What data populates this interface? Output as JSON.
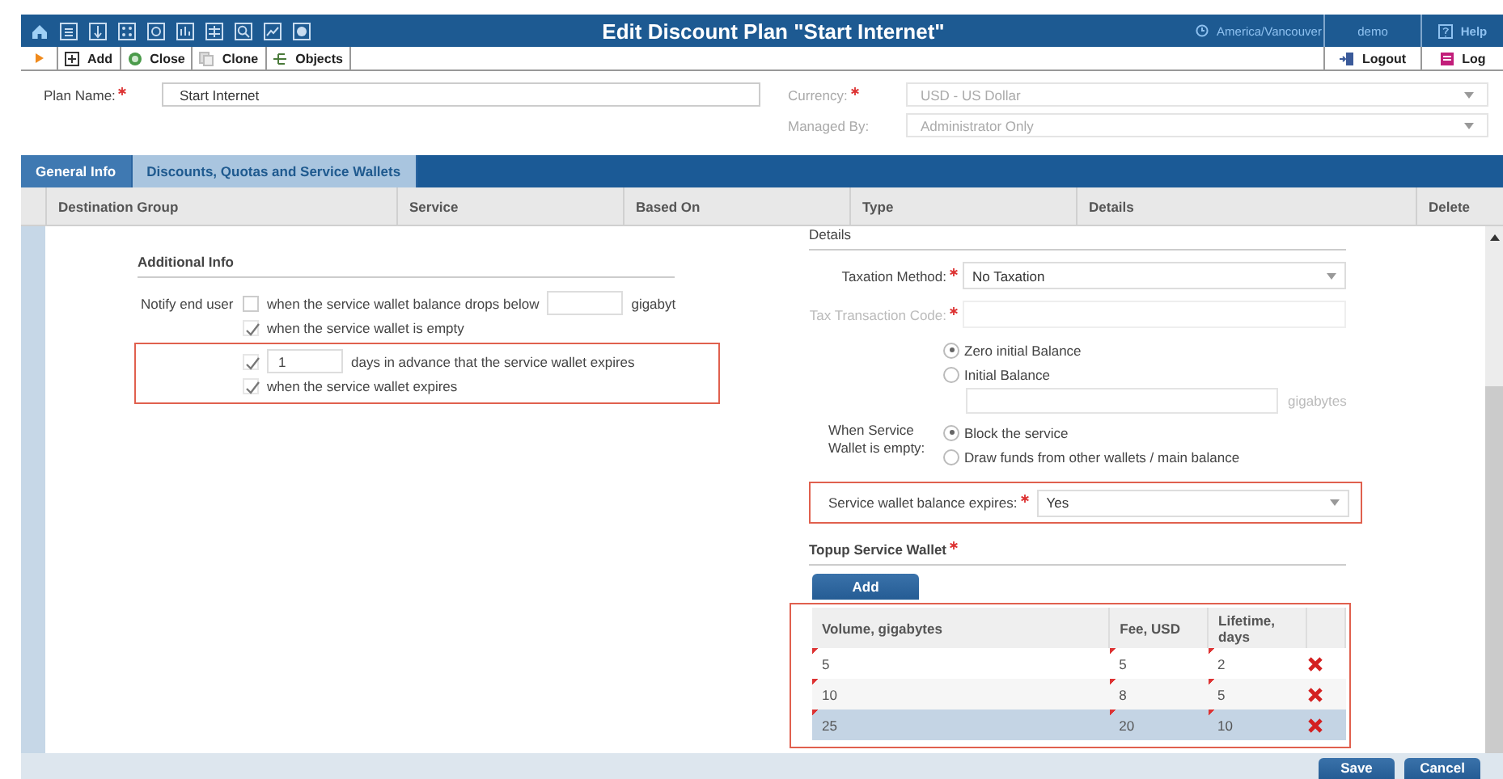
{
  "header": {
    "title": "Edit Discount Plan \"Start Internet\"",
    "timezone": "America/Vancouver",
    "user": "demo",
    "help": "Help"
  },
  "toolbar": {
    "left": [
      {
        "kind": "add",
        "label": "Add"
      },
      {
        "kind": "close",
        "label": "Close"
      },
      {
        "kind": "clone",
        "label": "Clone"
      },
      {
        "kind": "objects",
        "label": "Objects"
      }
    ],
    "right": [
      {
        "kind": "logout",
        "label": "Logout"
      },
      {
        "kind": "log",
        "label": "Log"
      }
    ]
  },
  "form": {
    "plan_name": {
      "label": "Plan Name:",
      "value": "Start Internet",
      "required": true
    },
    "currency": {
      "label": "Currency:",
      "value": "USD - US Dollar",
      "required": true,
      "disabled": true
    },
    "managed_by": {
      "label": "Managed By:",
      "value": "Administrator Only",
      "disabled": true
    }
  },
  "tabs": [
    {
      "label": "General Info",
      "selected": false
    },
    {
      "label": "Discounts, Quotas and Service Wallets",
      "selected": true
    }
  ],
  "table": {
    "columns": [
      "Destination Group",
      "Service",
      "Based On",
      "Type",
      "Details",
      "Delete"
    ]
  },
  "additional_info": {
    "title": "Additional Info",
    "notify_label": "Notify end user",
    "options": [
      {
        "kind": "threshold",
        "checked": false,
        "text": "when the service wallet balance drops below",
        "unit": "gigabyt"
      },
      {
        "kind": "plain",
        "checked": true,
        "text": "when the service wallet is empty"
      }
    ],
    "highlighted_options": [
      {
        "kind": "days",
        "checked": true,
        "value": "1",
        "text": "days in advance that the service wallet expires"
      },
      {
        "kind": "plain",
        "checked": true,
        "text": "when the service wallet expires"
      }
    ]
  },
  "details": {
    "title": "Details",
    "taxation_method": {
      "label": "Taxation Method:",
      "value": "No Taxation",
      "required": true
    },
    "tax_transaction_code": {
      "label": "Tax Transaction Code:",
      "required": true,
      "disabled": true
    },
    "initial_balance": {
      "options": [
        {
          "label": "Zero initial Balance",
          "selected": true
        },
        {
          "label": "Initial Balance",
          "selected": false
        }
      ],
      "unit": "gigabytes"
    },
    "when_empty": {
      "label": "When Service Wallet is empty:",
      "options": [
        {
          "label": "Block the service",
          "selected": true
        },
        {
          "label": "Draw funds from other wallets / main balance",
          "selected": false
        }
      ]
    },
    "balance_expires": {
      "label": "Service wallet balance expires:",
      "value": "Yes",
      "required": true
    }
  },
  "topup": {
    "title": "Topup Service Wallet",
    "required": true,
    "add_button": "Add",
    "columns": [
      "Volume, gigabytes",
      "Fee, USD",
      "Lifetime, days"
    ],
    "rows": [
      {
        "cells": [
          "5",
          "5",
          "2"
        ],
        "selected": false
      },
      {
        "cells": [
          "10",
          "8",
          "5"
        ],
        "selected": false
      },
      {
        "cells": [
          "25",
          "20",
          "10"
        ],
        "selected": true
      }
    ]
  },
  "footer": {
    "buttons": [
      "Save",
      "Cancel"
    ]
  }
}
